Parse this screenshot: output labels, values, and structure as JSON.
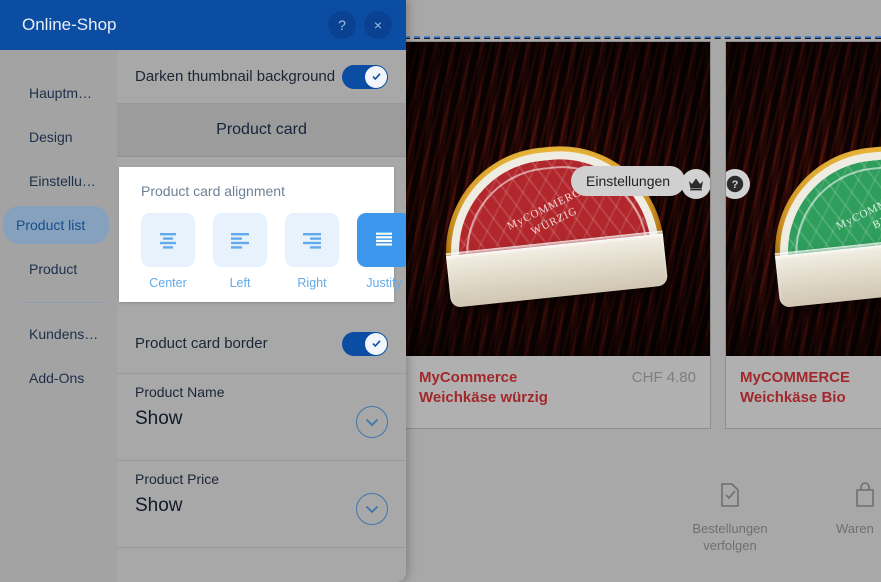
{
  "dialog": {
    "title": "Online-Shop",
    "help_label": "?",
    "close_label": "×",
    "sidebar": {
      "items": [
        {
          "label": "Hauptm…",
          "active": false
        },
        {
          "label": "Design",
          "active": false
        },
        {
          "label": "Einstellu…",
          "active": false
        },
        {
          "label": "Product list",
          "active": true
        },
        {
          "label": "Product",
          "active": false
        }
      ],
      "items_after_separator": [
        {
          "label": "Kundens…",
          "active": false
        },
        {
          "label": "Add-Ons",
          "active": false
        }
      ]
    },
    "settings": {
      "darken_thumbnail": {
        "label": "Darken thumbnail background",
        "value": "on"
      },
      "section_title": "Product card",
      "alignment": {
        "title": "Product card alignment",
        "options": [
          {
            "label": "Center",
            "icon": "align-center-icon",
            "selected": false
          },
          {
            "label": "Left",
            "icon": "align-left-icon",
            "selected": false
          },
          {
            "label": "Right",
            "icon": "align-right-icon",
            "selected": false
          },
          {
            "label": "Justify",
            "icon": "align-justify-icon",
            "selected": true
          }
        ]
      },
      "product_card_border": {
        "label": "Product card border",
        "value": "on"
      },
      "product_name": {
        "label": "Product Name",
        "value": "Show"
      },
      "product_price": {
        "label": "Product Price",
        "value": "Show"
      }
    }
  },
  "preview": {
    "tooltip": "Einstellungen",
    "cards": [
      {
        "title": "MyCommerce\nWeichkäse würzig",
        "title_line1": "MyCommerce",
        "title_line2": "Weichkäse würzig",
        "price": "CHF 4.80",
        "label_text_line1": "MyCOMMERCE",
        "label_text_line2": "WÜRZIG",
        "label_color": "#b2272c"
      },
      {
        "title_line1": "MyCOMMERCE",
        "title_line2": "Weichkäse Bio",
        "price": "",
        "label_text_line1": "MyCOMMERCE",
        "label_text_line2": "BIO",
        "label_color": "#2f9e5c"
      }
    ],
    "buttons": [
      {
        "name": "crown-icon",
        "label": ""
      },
      {
        "name": "help-icon",
        "label": "?"
      }
    ],
    "features": [
      {
        "label_line1": "Bestellungen",
        "label_line2": "verfolgen",
        "icon": "document-check-icon"
      },
      {
        "label_line1": "Waren",
        "label_line2": "",
        "icon": "shopping-bag-icon"
      }
    ]
  },
  "colors": {
    "header_blue": "#0b4da2",
    "accent_blue": "#3d97ec",
    "product_red": "#a2282c",
    "panel_gray": "#a8a8a8"
  }
}
